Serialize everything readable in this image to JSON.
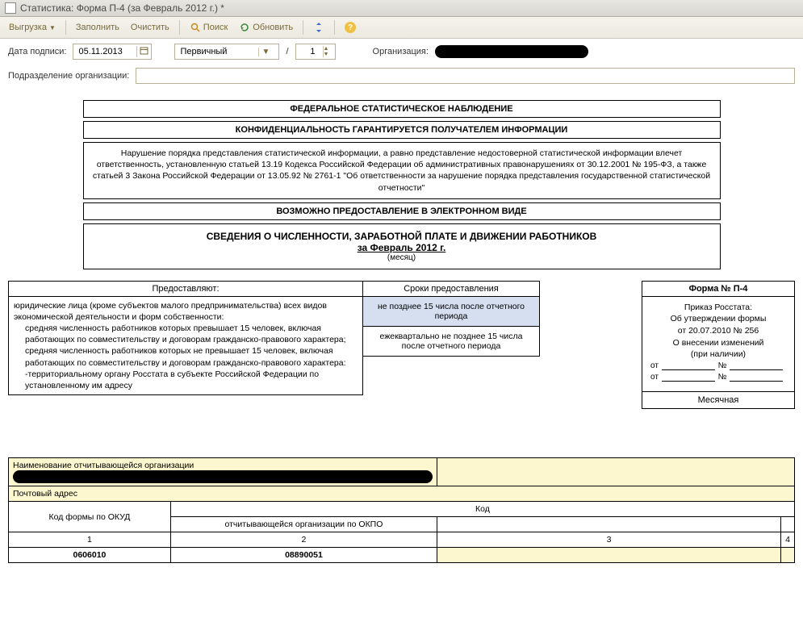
{
  "window": {
    "title": "Статистика: Форма П-4 (за Февраль 2012 г.) *"
  },
  "toolbar": {
    "upload": "Выгрузка",
    "fill": "Заполнить",
    "clear": "Очистить",
    "search": "Поиск",
    "refresh": "Обновить"
  },
  "form": {
    "date_label": "Дата подписи:",
    "date_value": "05.11.2013",
    "type_value": "Первичный",
    "slash": "/",
    "copy_value": "1",
    "org_label": "Организация:",
    "subdiv_label": "Подразделение организации:"
  },
  "banners": {
    "b1": "ФЕДЕРАЛЬНОЕ СТАТИСТИЧЕСКОЕ НАБЛЮДЕНИЕ",
    "b2": "КОНФИДЕНЦИАЛЬНОСТЬ ГАРАНТИРУЕТСЯ ПОЛУЧАТЕЛЕМ ИНФОРМАЦИИ",
    "b3": "Нарушение порядка представления статистической информации, а равно представление недостоверной статистической информации влечет ответственность, установленную статьей 13.19 Кодекса Российской Федерации об административных правонарушениях от 30.12.2001 № 195-ФЗ, а также статьей 3 Закона Российской Федерации от 13.05.92 № 2761-1 \"Об ответственности за нарушение порядка представления государственной статистической отчетности\"",
    "b4": "ВОЗМОЖНО ПРЕДОСТАВЛЕНИЕ В ЭЛЕКТРОННОМ ВИДЕ",
    "b5_line1": "СВЕДЕНИЯ О ЧИСЛЕННОСТИ, ЗАРАБОТНОЙ ПЛАТЕ И ДВИЖЕНИИ РАБОТНИКОВ",
    "b5_line2": "за Февраль 2012 г.",
    "b5_line3": "(месяц)"
  },
  "left": {
    "head": "Предоставляют:",
    "p1": "юридические лица (кроме субъектов малого предпринимательства) всех видов экономической деятельности и форм собственности:",
    "p2": "средняя численность работников которых превышает 15 человек, включая работающих по совместительству и договорам гражданско-правового характера;",
    "p3": "средняя численность работников которых не превышает 15 человек, включая работающих по совместительству и договорам гражданско-правового характера:",
    "p4": "-территориальному органу Росстата в субъекте Российской Федерации по установленному им адресу"
  },
  "mid": {
    "head": "Сроки предоставления",
    "s1": "не позднее 15 числа после отчетного периода",
    "s2": "ежеквартально не позднее 15 числа после отчетного периода"
  },
  "right": {
    "head": "Форма № П-4",
    "l1": "Приказ Росстата:",
    "l2": "Об утверждении формы",
    "l3": "от 20.07.2010 № 256",
    "l4": "О внесении изменений",
    "l5": "(при наличии)",
    "from": "от",
    "num": "№",
    "foot": "Месячная"
  },
  "table": {
    "r1": "Наименование отчитывающейся организации",
    "r2": "Почтовый адрес",
    "code": "Код",
    "h1": "Код формы по ОКУД",
    "h2": "отчитывающейся организации по ОКПО",
    "n1": "1",
    "n2": "2",
    "n3": "3",
    "n4": "4",
    "v1": "0606010",
    "v2": "08890051"
  }
}
